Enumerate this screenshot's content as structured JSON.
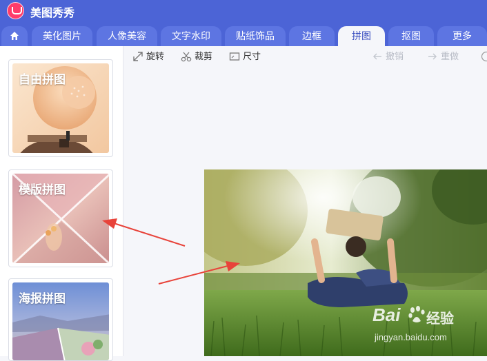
{
  "app": {
    "title": "美图秀秀"
  },
  "tabs": [
    {
      "label": "美化图片"
    },
    {
      "label": "人像美容"
    },
    {
      "label": "文字水印"
    },
    {
      "label": "贴纸饰品"
    },
    {
      "label": "边框"
    },
    {
      "label": "拼图",
      "active": true
    },
    {
      "label": "抠图"
    },
    {
      "label": "更多"
    }
  ],
  "toolbar": {
    "rotate": "旋转",
    "crop": "裁剪",
    "size": "尺寸",
    "undo": "撤销",
    "redo": "重做"
  },
  "sidebar": {
    "cards": [
      {
        "label": "自由拼图"
      },
      {
        "label": "模版拼图"
      },
      {
        "label": "海报拼图"
      }
    ]
  },
  "watermark": {
    "brand": "Bai",
    "cn": "经验",
    "url": "jingyan.baidu.com"
  },
  "colors": {
    "accent": "#4c64d6",
    "tab": "#5d75e2",
    "arrow": "#e8433a"
  }
}
